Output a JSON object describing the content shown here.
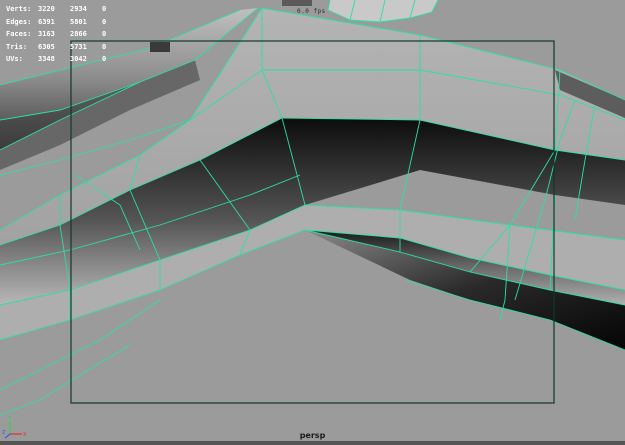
{
  "hud": {
    "rows": [
      {
        "label": "Verts:",
        "v1": "3220",
        "v2": "2934",
        "v3": "0"
      },
      {
        "label": "Edges:",
        "v1": "6391",
        "v2": "5801",
        "v3": "0"
      },
      {
        "label": "Faces:",
        "v1": "3163",
        "v2": "2866",
        "v3": "0"
      },
      {
        "label": "Tris:",
        "v1": "6305",
        "v2": "5731",
        "v3": "0"
      },
      {
        "label": "UVs:",
        "v1": "3348",
        "v2": "3042",
        "v3": "0"
      }
    ]
  },
  "frame_rate_text": "0.0 fps",
  "camera_label": "persp",
  "axis": {
    "x": "X",
    "y": "Y",
    "z": "Z"
  },
  "colors": {
    "viewport_bg": "#9b9b9b",
    "wireframe": "#2ce0a0",
    "resolution_gate": "#0e3a2a",
    "hud_text": "#ffffff"
  }
}
